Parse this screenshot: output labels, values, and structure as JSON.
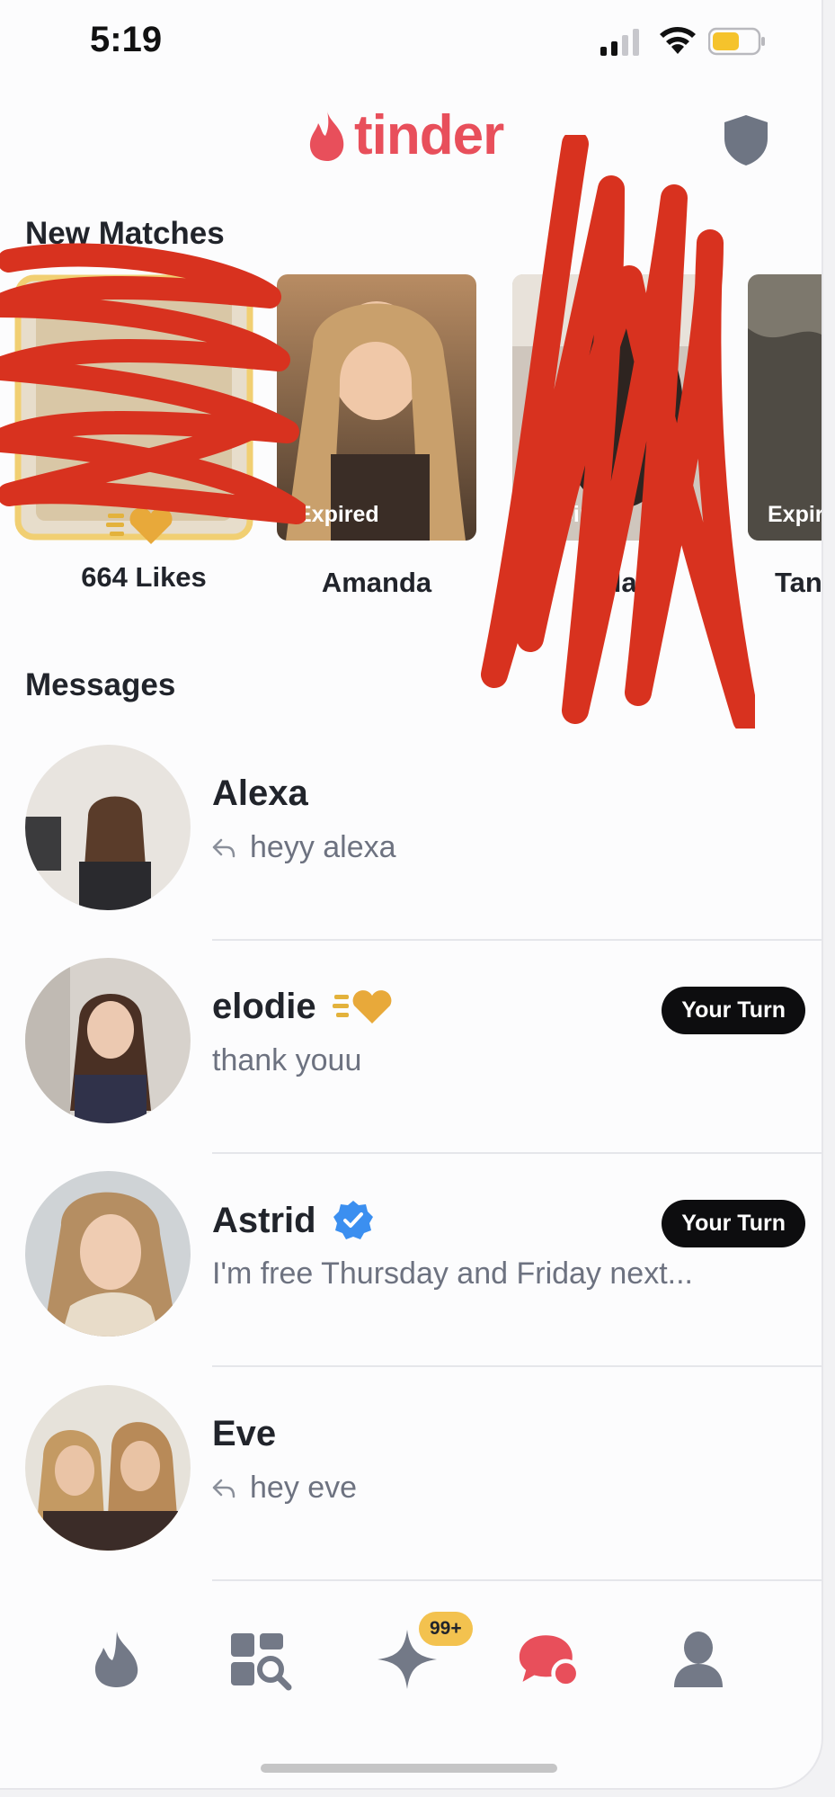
{
  "status": {
    "time": "5:19"
  },
  "header": {
    "logo_text": "tinder",
    "brand_color": "#e84f5b"
  },
  "new_matches": {
    "title": "New Matches",
    "likes_label": "664 Likes",
    "items": [
      {
        "name": "Amanda",
        "status": "Expired"
      },
      {
        "name": "Ella",
        "status": "Expired"
      },
      {
        "name": "Tan",
        "status": "Expir"
      }
    ]
  },
  "messages": {
    "title": "Messages",
    "items": [
      {
        "name": "Alexa",
        "preview": "heyy alexa",
        "replied": true,
        "badge": ""
      },
      {
        "name": "elodie",
        "preview": "thank youu",
        "replied": false,
        "badge": "Your Turn",
        "super_like": true
      },
      {
        "name": "Astrid",
        "preview": "I'm free Thursday and Friday next...",
        "replied": false,
        "badge": "Your Turn",
        "verified": true
      },
      {
        "name": "Eve",
        "preview": "hey eve",
        "replied": true,
        "badge": ""
      }
    ]
  },
  "tabbar": {
    "items": [
      "flame-icon",
      "explore-icon",
      "sparkle-icon",
      "chat-icon",
      "profile-icon"
    ],
    "sparkle_badge": "99+",
    "active": "chat-icon"
  }
}
